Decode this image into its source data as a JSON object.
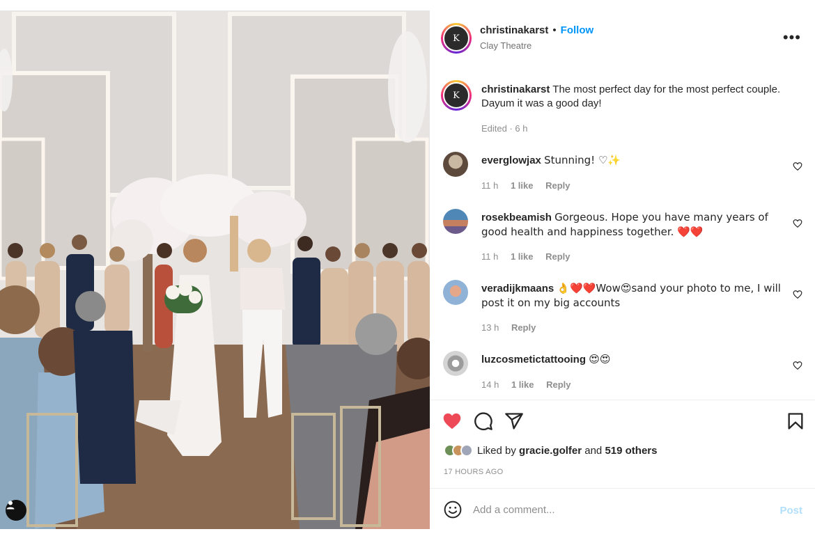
{
  "post": {
    "username": "christinakarst",
    "separator": "•",
    "follow_label": "Follow",
    "location": "Clay Theatre",
    "more_icon": "more-horizontal-icon",
    "more_label": "•••",
    "avatar_monogram": "K",
    "caption": "The most perfect day for the most perfect couple. Dayum it was a good day!",
    "caption_meta": "Edited · 6 h"
  },
  "comments": [
    {
      "username": "everglowjax",
      "text": "Stunning! ♡✨",
      "time": "11 h",
      "likes": "1 like",
      "reply": "Reply"
    },
    {
      "username": "rosekbeamish",
      "text": "Gorgeous. Hope you have many years of good health and happiness together. ❤️❤️",
      "time": "11 h",
      "likes": "1 like",
      "reply": "Reply"
    },
    {
      "username": "veradijkmaans",
      "text": "👌❤️❤️Wow😍sand your photo to me, I will post it on my big accounts",
      "time": "13 h",
      "likes": "",
      "reply": "Reply"
    },
    {
      "username": "luzcosmetictattooing",
      "text": "😍😍",
      "time": "14 h",
      "likes": "1 like",
      "reply": "Reply"
    }
  ],
  "likes": {
    "prefix": "Liked by",
    "first_user": "gracie.golfer",
    "connector": "and",
    "others": "519 others"
  },
  "timestamp": "17 HOURS AGO",
  "add_comment": {
    "placeholder": "Add a comment...",
    "post_label": "Post"
  },
  "colors": {
    "like_red": "#ed4956",
    "follow_blue": "#0095f6",
    "post_disabled": "#b2dffc"
  }
}
